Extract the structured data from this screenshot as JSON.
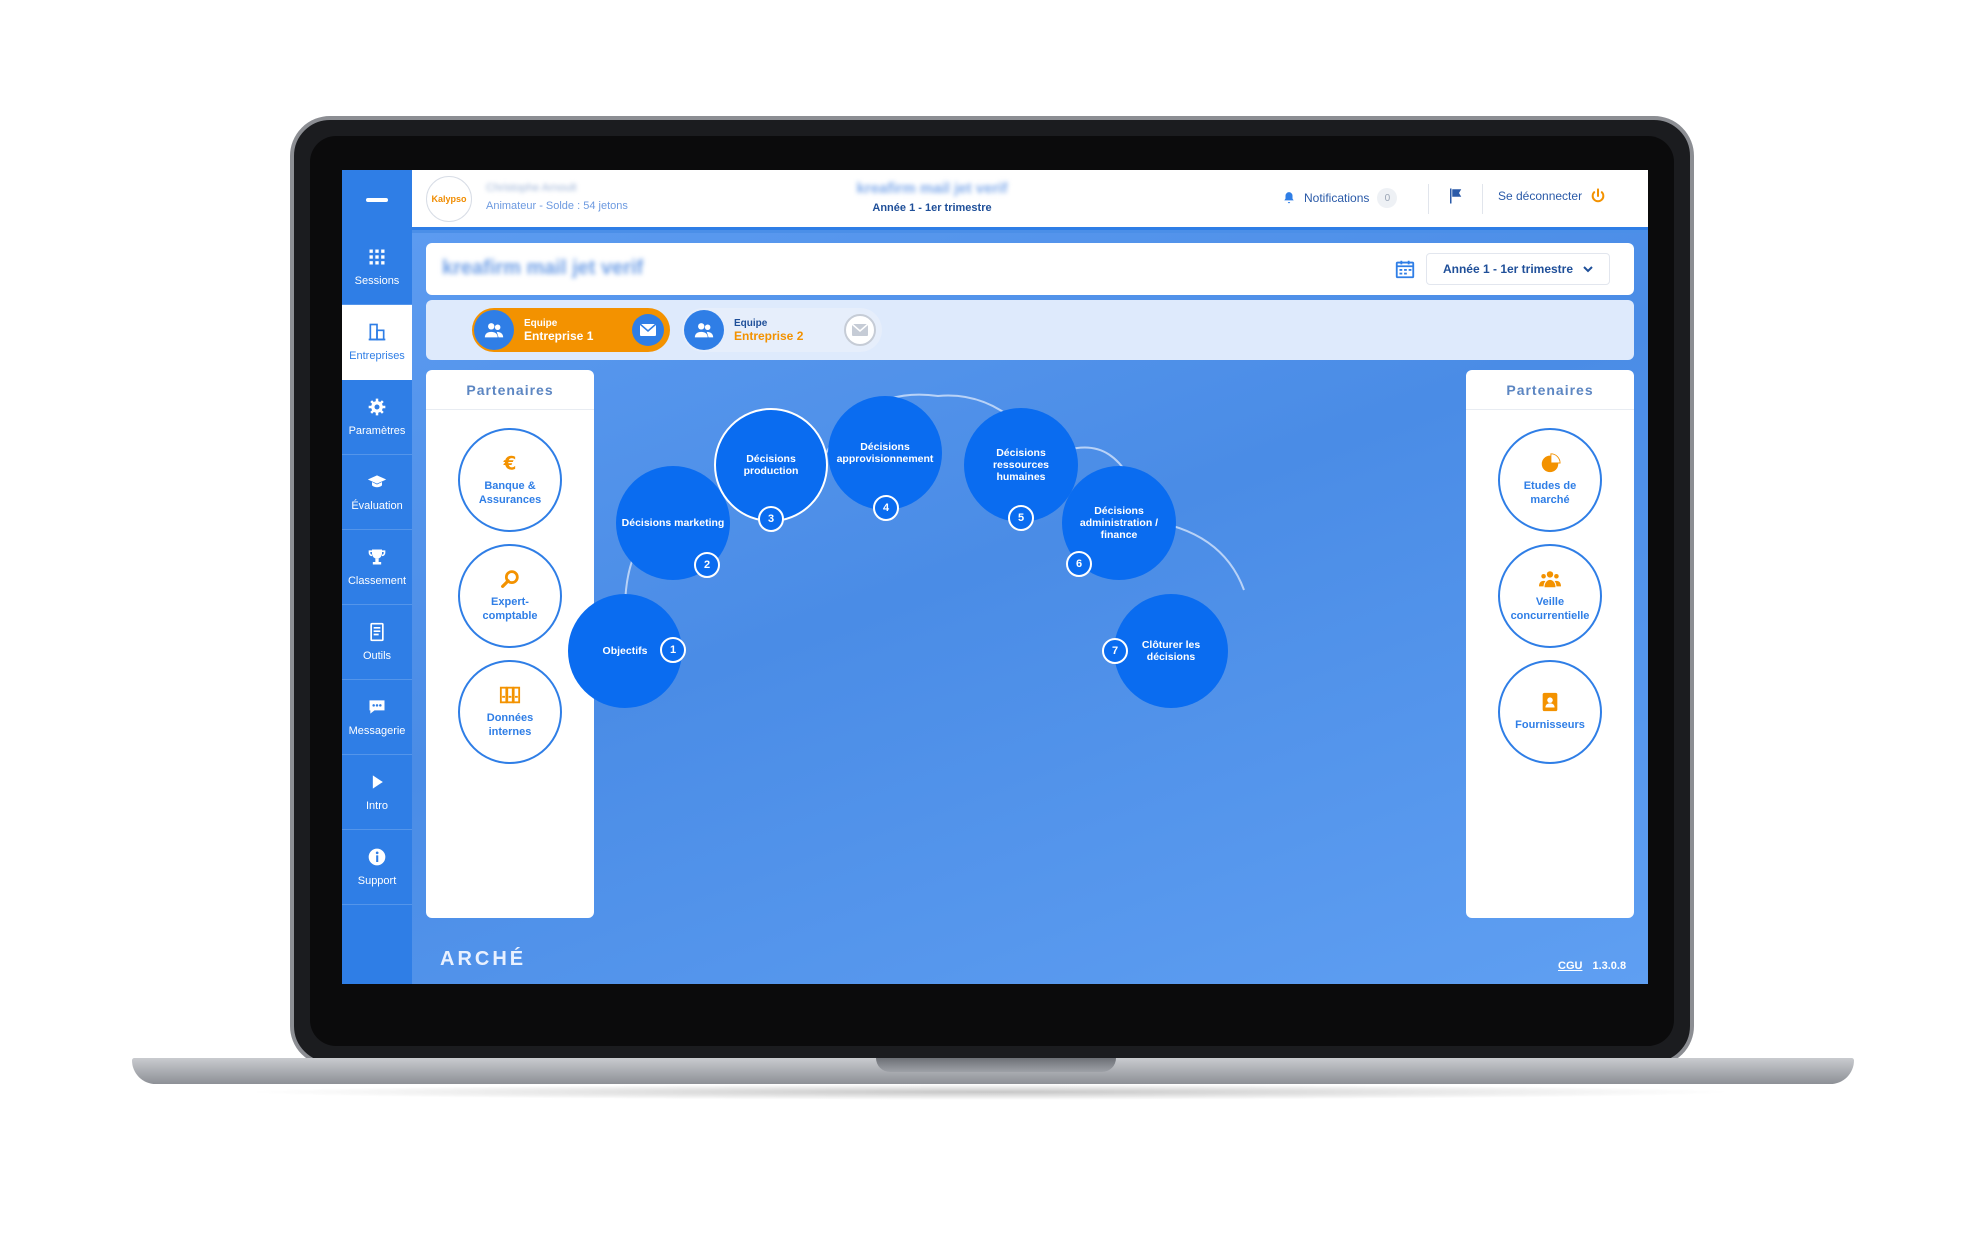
{
  "header": {
    "app_logo": "Kalypso",
    "user_name": "Christophe Arnoult",
    "user_role": "Animateur - Solde : 54 jetons",
    "session_title": "kreafirm mail jet verif",
    "session_period": "Année 1 - 1er trimestre",
    "notifications_label": "Notifications",
    "notifications_count": "0",
    "logout_label": "Se déconnecter"
  },
  "sidebar": {
    "items": [
      {
        "label": "Sessions",
        "icon": "grid-icon"
      },
      {
        "label": "Entreprises",
        "icon": "buildings-icon"
      },
      {
        "label": "Paramètres",
        "icon": "gear-icon"
      },
      {
        "label": "Évaluation",
        "icon": "graduation-cap-icon"
      },
      {
        "label": "Classement",
        "icon": "trophy-icon"
      },
      {
        "label": "Outils",
        "icon": "document-icon"
      },
      {
        "label": "Messagerie",
        "icon": "chat-icon"
      },
      {
        "label": "Intro",
        "icon": "play-icon"
      },
      {
        "label": "Support",
        "icon": "info-icon"
      }
    ],
    "active_index": 1
  },
  "session_bar": {
    "title": "kreafirm mail jet verif",
    "period_select": "Année 1 - 1er trimestre"
  },
  "teams": [
    {
      "label": "Equipe",
      "name": "Entreprise 1",
      "active": true
    },
    {
      "label": "Equipe",
      "name": "Entreprise 2",
      "active": false
    }
  ],
  "partners_left": {
    "title": "Partenaires",
    "items": [
      {
        "label": "Banque & Assurances",
        "icon": "euro-icon"
      },
      {
        "label": "Expert-comptable",
        "icon": "magnifier-icon"
      },
      {
        "label": "Données internes",
        "icon": "binders-icon"
      }
    ]
  },
  "partners_right": {
    "title": "Partenaires",
    "items": [
      {
        "label": "Etudes de marché",
        "icon": "pie-chart-icon"
      },
      {
        "label": "Veille concurrentielle",
        "icon": "people-icon"
      },
      {
        "label": "Fournisseurs",
        "icon": "contact-book-icon"
      }
    ]
  },
  "decisions": [
    {
      "label": "Objectifs",
      "number": "1"
    },
    {
      "label": "Décisions marketing",
      "number": "2"
    },
    {
      "label": "Décisions production",
      "number": "3"
    },
    {
      "label": "Décisions approvisionnement",
      "number": "4"
    },
    {
      "label": "Décisions ressources humaines",
      "number": "5"
    },
    {
      "label": "Décisions administration / finance",
      "number": "6"
    },
    {
      "label": "Clôturer les décisions",
      "number": "7"
    }
  ],
  "footer": {
    "brand": "ARCHÉ",
    "cgu": "CGU",
    "version": "1.3.0.8"
  },
  "colors": {
    "primary": "#2f7ee6",
    "decision": "#0a6cf0",
    "accent": "#f39200"
  }
}
